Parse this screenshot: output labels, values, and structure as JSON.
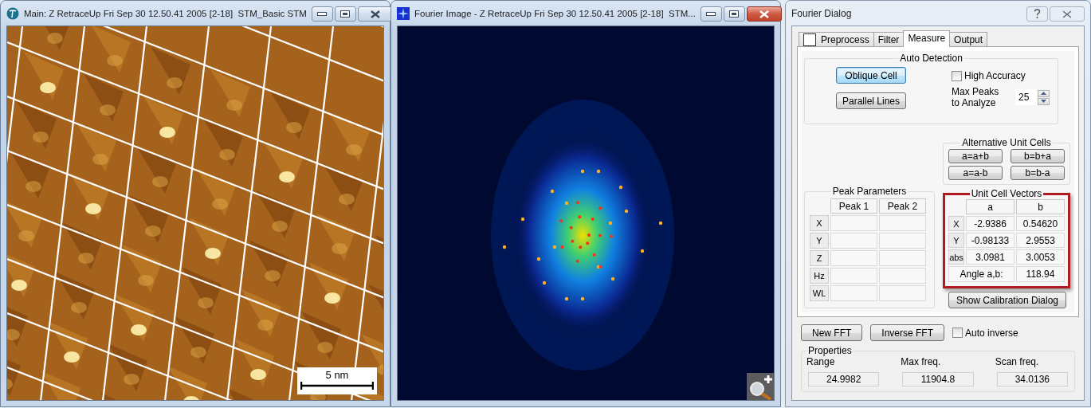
{
  "windows": [
    {
      "kind": "stm",
      "title": "Main: Z RetraceUp Fri Sep 30 12.50.41 2005 [2-18]  STM_Basic STM",
      "close_hover": false,
      "scale_bar": "5 nm"
    },
    {
      "kind": "fft",
      "title": "Fourier Image - Z RetraceUp Fri Sep 30 12.50.41 2005 [2-18]  STM...",
      "close_hover": true
    }
  ],
  "dialog": {
    "title": "Fourier Dialog",
    "tabs": [
      {
        "kind": "checkbox",
        "label": "Preprocess",
        "checked": false,
        "selected": false
      },
      {
        "kind": "plain",
        "label": "Filter",
        "selected": false
      },
      {
        "kind": "plain",
        "label": "Measure",
        "selected": true
      },
      {
        "kind": "plain",
        "label": "Output",
        "selected": false
      }
    ],
    "auto_detection": {
      "title": "Auto Detection",
      "buttons": [
        {
          "label": "Oblique Cell",
          "default": true
        },
        {
          "label": "Parallel Lines",
          "default": false
        }
      ],
      "high_accuracy": {
        "label": "High Accuracy",
        "checked": false
      },
      "max_peaks": {
        "label": "Max Peaks to Analyze",
        "value": "25"
      }
    },
    "alternative_unit_cells": {
      "title": "Alternative Unit Cells",
      "buttons": [
        "a=a+b",
        "b=b+a",
        "a=a-b",
        "b=b-a"
      ]
    },
    "peak_parameters": {
      "title": "Peak Parameters",
      "columns": [
        "Peak 1",
        "Peak 2"
      ],
      "rows": [
        "X",
        "Y",
        "Z",
        "Hz",
        "WL"
      ]
    },
    "unit_cell_vectors": {
      "title": "Unit Cell Vectors",
      "highlighted": true,
      "columns": [
        "a",
        "b"
      ],
      "rows": [
        {
          "label": "X",
          "values": [
            "-2.9386",
            "0.54620"
          ]
        },
        {
          "label": "Y",
          "values": [
            "-0.98133",
            "2.9553"
          ]
        },
        {
          "label": "abs",
          "values": [
            "3.0981",
            "3.0053"
          ]
        }
      ],
      "angle": {
        "label": "Angle a,b:",
        "value": "118.94"
      }
    },
    "calibration_button": "Show Calibration Dialog",
    "bottom_buttons": [
      "New FFT",
      "Inverse FFT"
    ],
    "auto_inverse": {
      "label": "Auto inverse",
      "checked": false
    },
    "properties": {
      "title": "Properties",
      "fields": [
        {
          "label": "Range",
          "value": "24.9982"
        },
        {
          "label": "Max freq.",
          "value": "11904.8"
        },
        {
          "label": "Scan freq.",
          "value": "34.0136"
        }
      ]
    }
  }
}
